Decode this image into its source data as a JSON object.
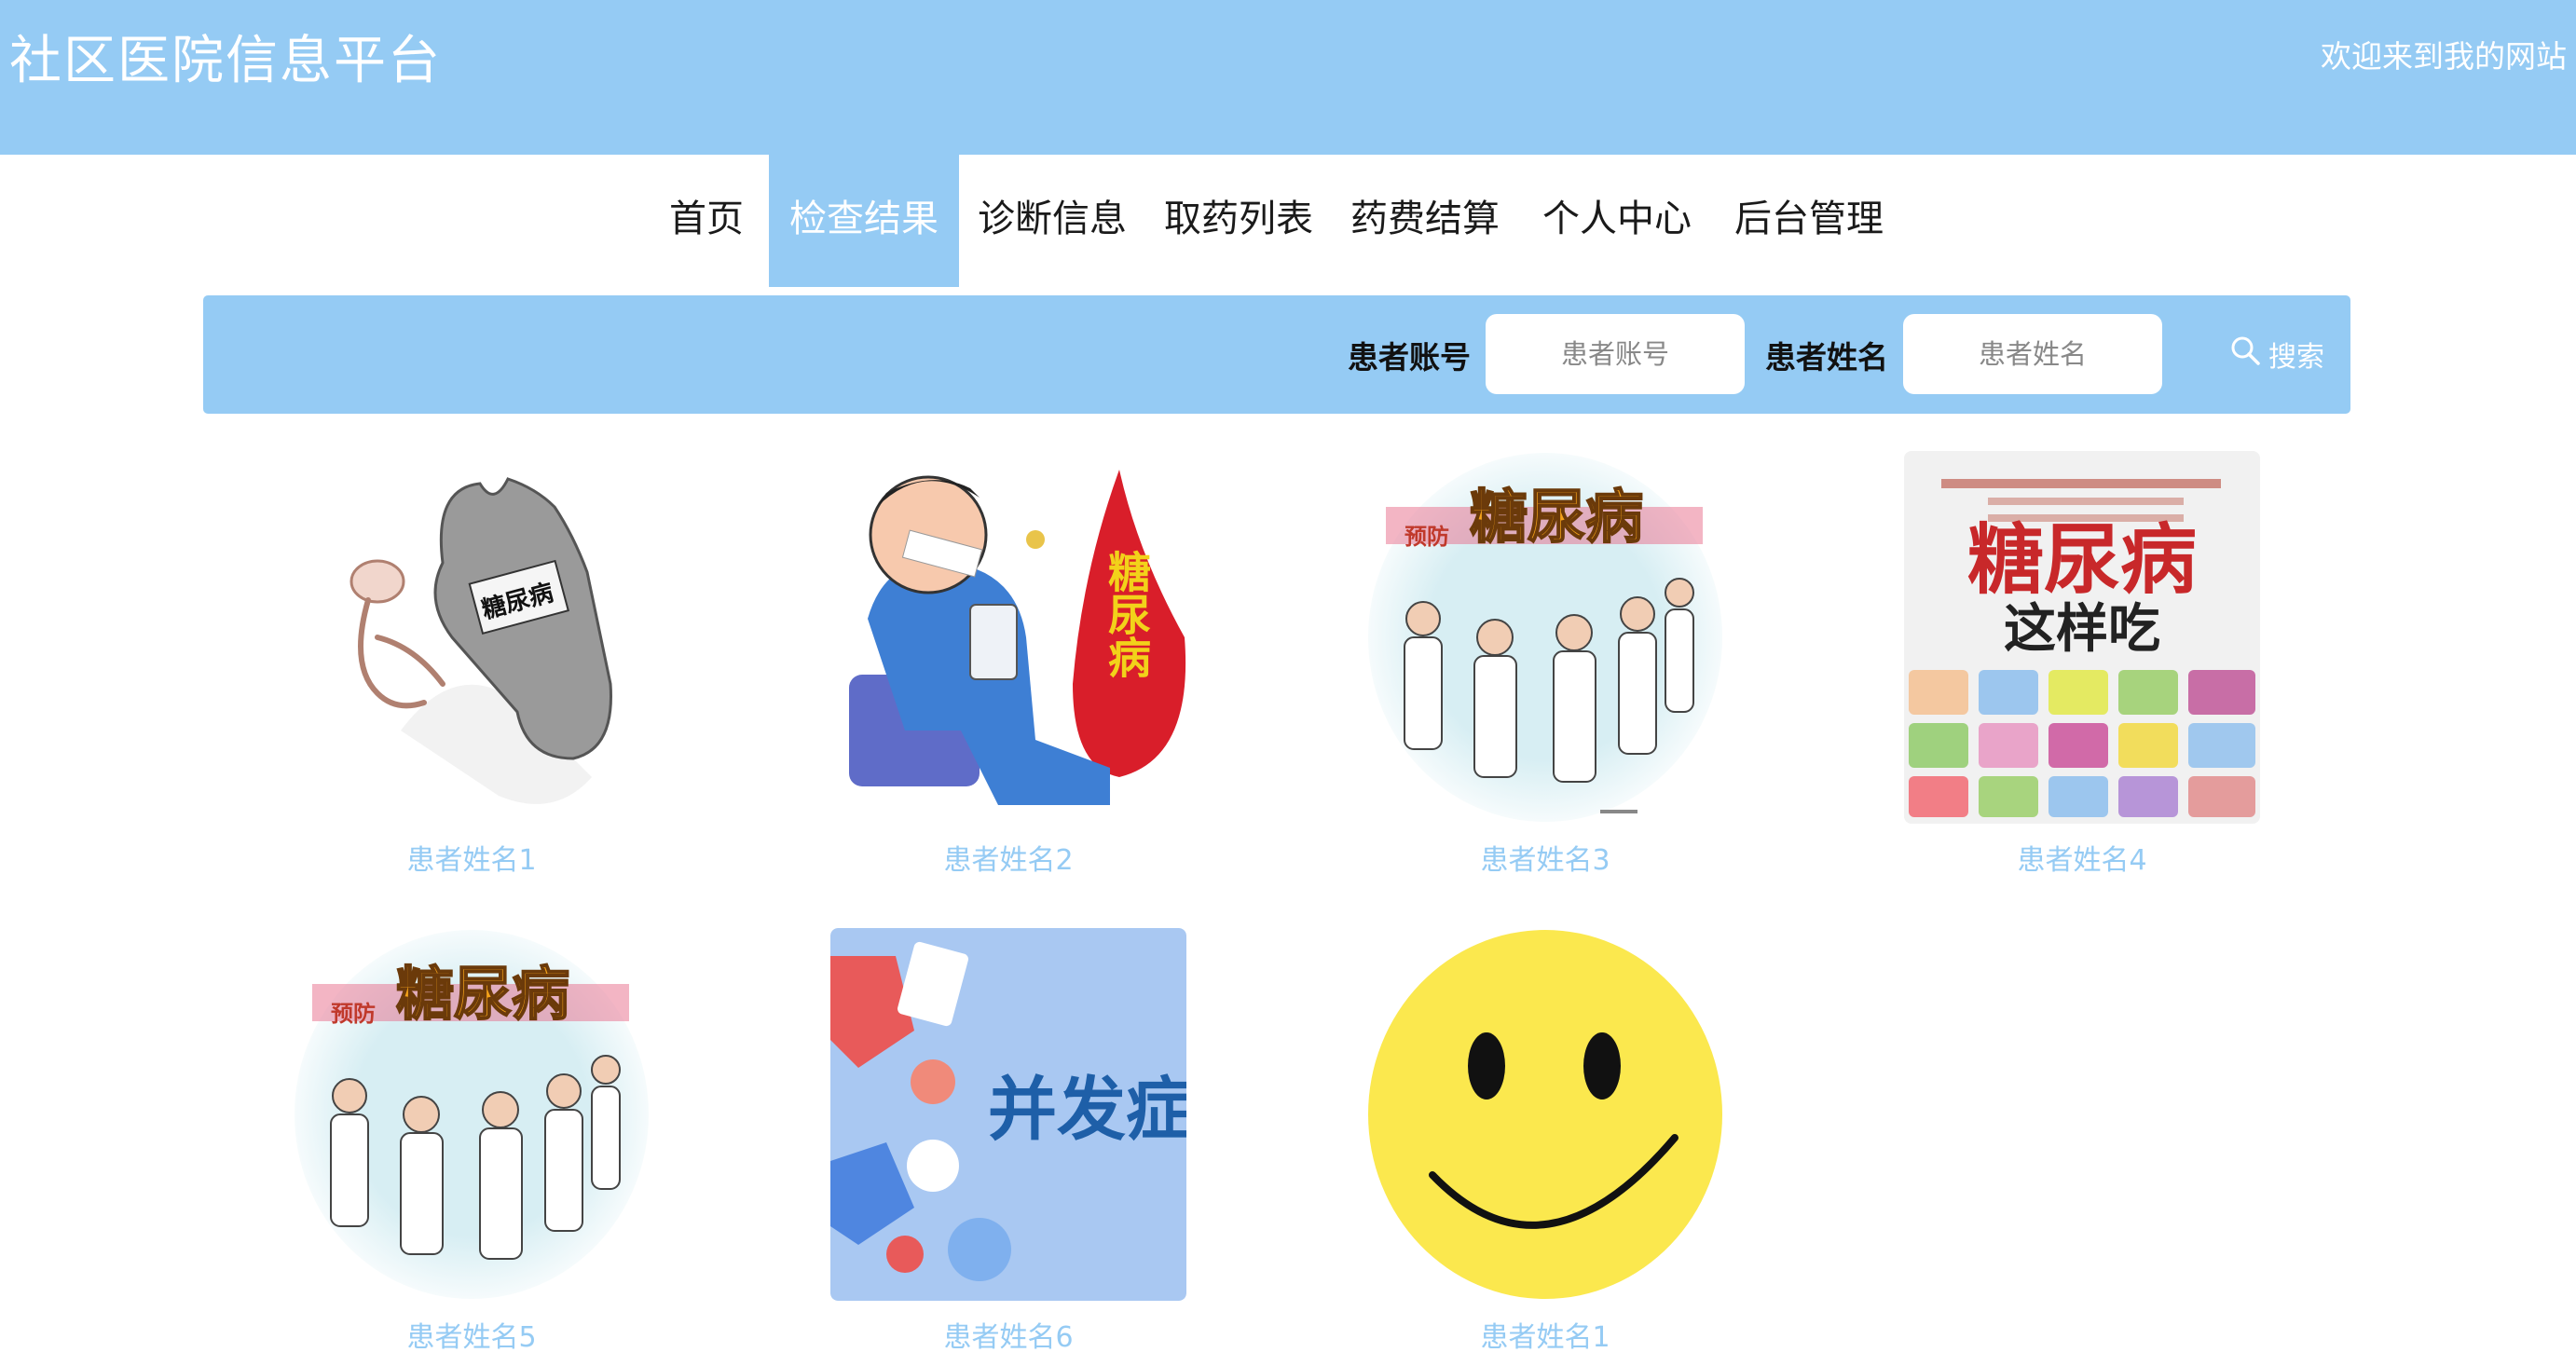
{
  "header": {
    "title": "社区医院信息平台",
    "welcome": "欢迎来到我的网站"
  },
  "nav": {
    "items": [
      {
        "label": "首页"
      },
      {
        "label": "检查结果"
      },
      {
        "label": "诊断信息"
      },
      {
        "label": "取药列表"
      },
      {
        "label": "药费结算"
      },
      {
        "label": "个人中心"
      },
      {
        "label": "后台管理"
      }
    ],
    "active": "检查结果"
  },
  "search": {
    "account_label": "患者账号",
    "account_placeholder": "患者账号",
    "name_label": "患者姓名",
    "name_placeholder": "患者姓名",
    "button_label": "搜索"
  },
  "colors": {
    "accent": "#95cbf4",
    "caption": "#95cbf4"
  },
  "cards": [
    {
      "name": "患者姓名1",
      "thumb_text": "糖尿病"
    },
    {
      "name": "患者姓名2",
      "thumb_text": "糖尿病"
    },
    {
      "name": "患者姓名3",
      "thumb_text": "糖尿病",
      "thumb_sub": "预防"
    },
    {
      "name": "患者姓名4",
      "thumb_text": "糖尿病",
      "thumb_sub": "这样吃"
    },
    {
      "name": "患者姓名5",
      "thumb_text": "糖尿病",
      "thumb_sub": "预防"
    },
    {
      "name": "患者姓名6",
      "thumb_text": "并发症"
    },
    {
      "name": "患者姓名1"
    }
  ]
}
